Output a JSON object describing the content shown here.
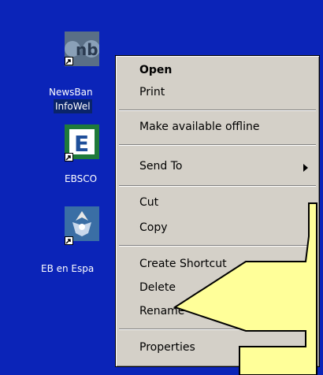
{
  "desktop": {
    "icons": [
      {
        "label_line1": "NewsBan",
        "label_line2": "InfoWel",
        "icon": "newsbank-icon"
      },
      {
        "label": "EBSCO",
        "icon": "ebsco-icon"
      },
      {
        "label": "EB en Espa",
        "icon": "eb-espanol-icon"
      }
    ]
  },
  "context_menu": {
    "items": [
      {
        "label": "Open",
        "bold": true
      },
      {
        "label": "Print"
      },
      {
        "label": "Make available offline"
      },
      {
        "label": "Send To",
        "submenu": true
      },
      {
        "label": "Cut"
      },
      {
        "label": "Copy"
      },
      {
        "label": "Create Shortcut"
      },
      {
        "label": "Delete"
      },
      {
        "label": "Rename"
      },
      {
        "label": "Properties"
      }
    ]
  },
  "colors": {
    "desktop_bg": "#0b24b8",
    "menu_bg": "#d4d0c8",
    "callout_fill": "#ffff99",
    "selection": "#0a246a"
  }
}
